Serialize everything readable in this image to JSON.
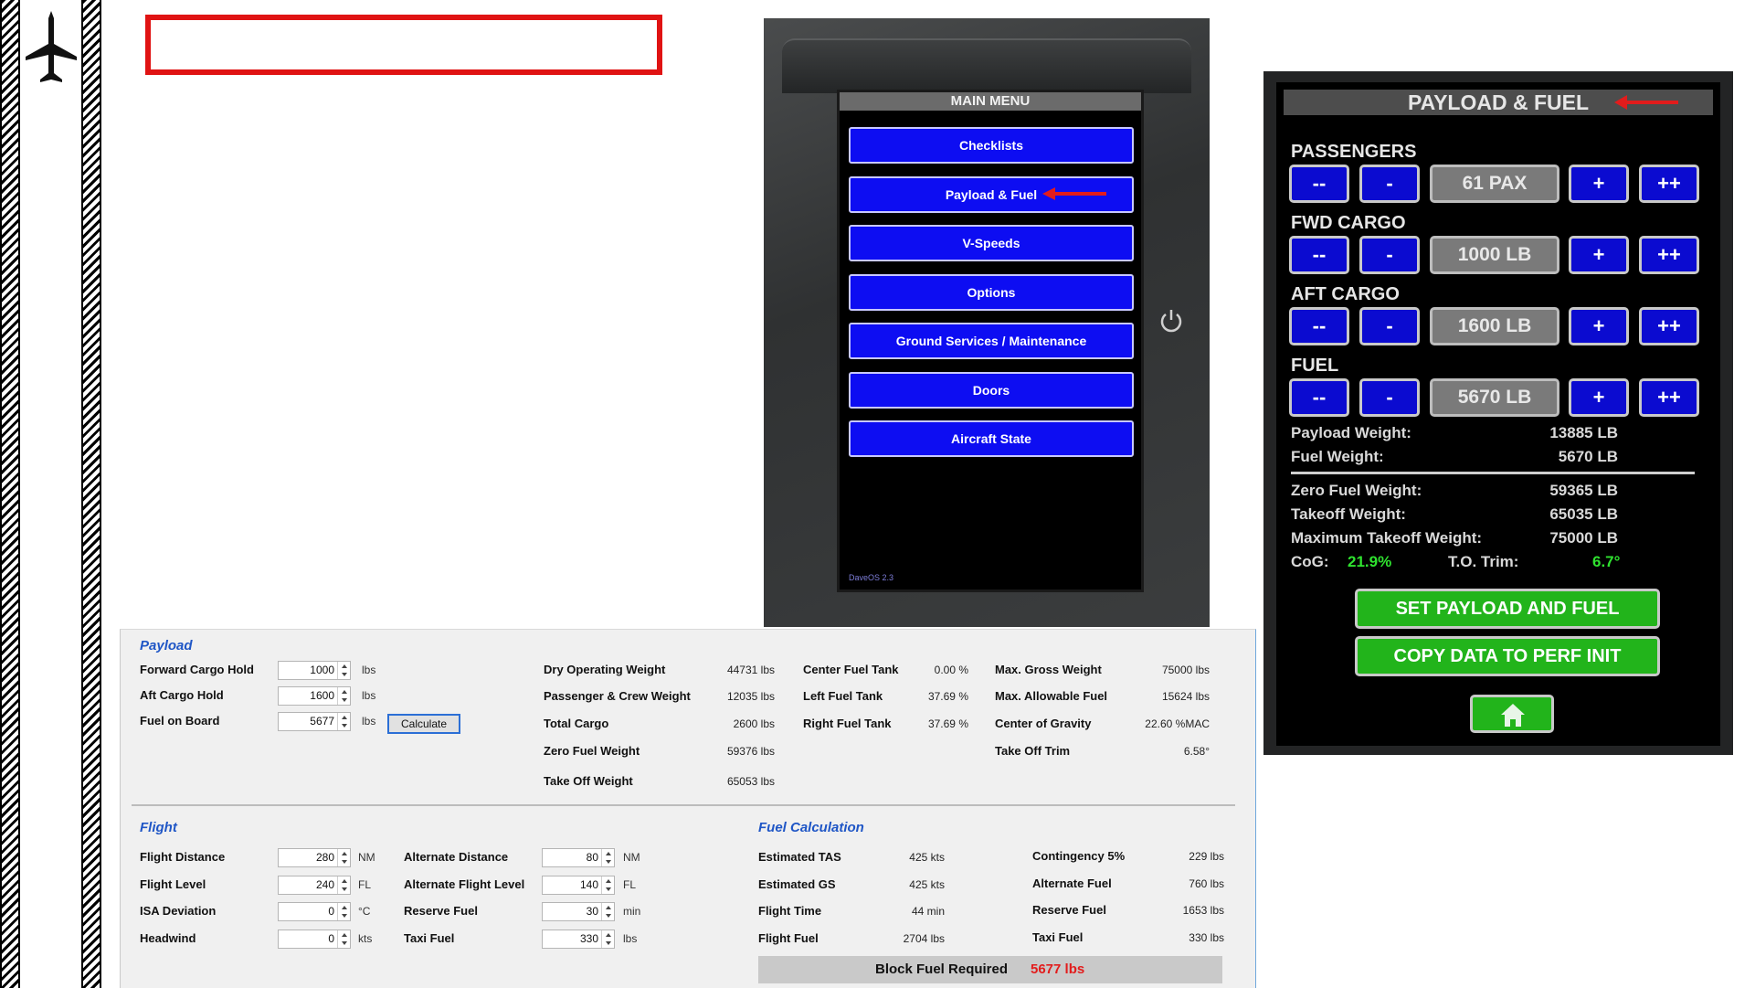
{
  "tablet": {
    "header": "MAIN MENU",
    "items": [
      "Checklists",
      "Payload & Fuel",
      "V-Speeds",
      "Options",
      "Ground Services / Maintenance",
      "Doors",
      "Aircraft State"
    ],
    "os_version": "DaveOS 2.3",
    "power_icon": "power-icon"
  },
  "payload_fuel_panel": {
    "title": "PAYLOAD & FUEL",
    "sections": [
      {
        "label": "PASSENGERS",
        "value": "61 PAX"
      },
      {
        "label": "FWD CARGO",
        "value": "1000 LB"
      },
      {
        "label": "AFT CARGO",
        "value": "1600 LB"
      },
      {
        "label": "FUEL",
        "value": "5670 LB"
      }
    ],
    "buttons": {
      "dec_big": "--",
      "dec": "-",
      "inc": "+",
      "inc_big": "++"
    },
    "payload_weight_label": "Payload Weight:",
    "payload_weight": "13885 LB",
    "fuel_weight_label": "Fuel Weight:",
    "fuel_weight": "5670 LB",
    "zfw_label": "Zero Fuel Weight:",
    "zfw": "59365 LB",
    "tow_label": "Takeoff Weight:",
    "tow": "65035 LB",
    "mtow_label": "Maximum Takeoff Weight:",
    "mtow": "75000 LB",
    "cog_label": "CoG:",
    "cog": "21.9%",
    "trim_label": "T.O. Trim:",
    "trim": "6.7°",
    "set_button": "SET PAYLOAD AND FUEL",
    "copy_button": "COPY DATA TO PERF INIT",
    "home_icon": "home-icon",
    "accent_green": "#22b41b",
    "button_blue": "#0b0bd0"
  },
  "calculator": {
    "payload": {
      "title": "Payload",
      "fields": [
        {
          "label": "Forward Cargo Hold",
          "value": "1000",
          "unit": "lbs"
        },
        {
          "label": "Aft Cargo Hold",
          "value": "1600",
          "unit": "lbs"
        },
        {
          "label": "Fuel on Board",
          "value": "5677",
          "unit": "lbs"
        }
      ],
      "calculate_button": "Calculate",
      "weights": [
        {
          "label": "Dry Operating Weight",
          "value": "44731 lbs"
        },
        {
          "label": "Passenger & Crew Weight",
          "value": "12035 lbs"
        },
        {
          "label": "Total Cargo",
          "value": "2600 lbs"
        },
        {
          "label": "Zero Fuel Weight",
          "value": "59376 lbs"
        },
        {
          "label": "Take Off Weight",
          "value": "65053 lbs"
        }
      ],
      "tanks": [
        {
          "label": "Center Fuel Tank",
          "value": "0.00 %"
        },
        {
          "label": "Left Fuel Tank",
          "value": "37.69 %"
        },
        {
          "label": "Right Fuel Tank",
          "value": "37.69 %"
        }
      ],
      "limits": [
        {
          "label": "Max. Gross Weight",
          "value": "75000 lbs"
        },
        {
          "label": "Max. Allowable Fuel",
          "value": "15624 lbs"
        },
        {
          "label": "Center of Gravity",
          "value": "22.60 %MAC"
        },
        {
          "label": "Take Off Trim",
          "value": "6.58°"
        }
      ]
    },
    "flight": {
      "title": "Flight",
      "left": [
        {
          "label": "Flight Distance",
          "value": "280",
          "unit": "NM"
        },
        {
          "label": "Flight Level",
          "value": "240",
          "unit": "FL"
        },
        {
          "label": "ISA Deviation",
          "value": "0",
          "unit": "°C"
        },
        {
          "label": "Headwind",
          "value": "0",
          "unit": "kts"
        }
      ],
      "right": [
        {
          "label": "Alternate Distance",
          "value": "80",
          "unit": "NM"
        },
        {
          "label": "Alternate Flight Level",
          "value": "140",
          "unit": "FL"
        },
        {
          "label": "Reserve Fuel",
          "value": "30",
          "unit": "min"
        },
        {
          "label": "Taxi Fuel",
          "value": "330",
          "unit": "lbs"
        }
      ]
    },
    "fuel_calc": {
      "title": "Fuel Calculation",
      "left": [
        {
          "label": "Estimated TAS",
          "value": "425 kts"
        },
        {
          "label": "Estimated GS",
          "value": "425 kts"
        },
        {
          "label": "Flight Time",
          "value": "44 min"
        },
        {
          "label": "Flight Fuel",
          "value": "2704 lbs"
        }
      ],
      "right": [
        {
          "label": "Contingency 5%",
          "value": "229 lbs"
        },
        {
          "label": "Alternate Fuel",
          "value": "760 lbs"
        },
        {
          "label": "Reserve Fuel",
          "value": "1653 lbs"
        },
        {
          "label": "Taxi Fuel",
          "value": "330 lbs"
        }
      ],
      "block_label": "Block Fuel Required",
      "block_value": "5677 lbs"
    }
  }
}
